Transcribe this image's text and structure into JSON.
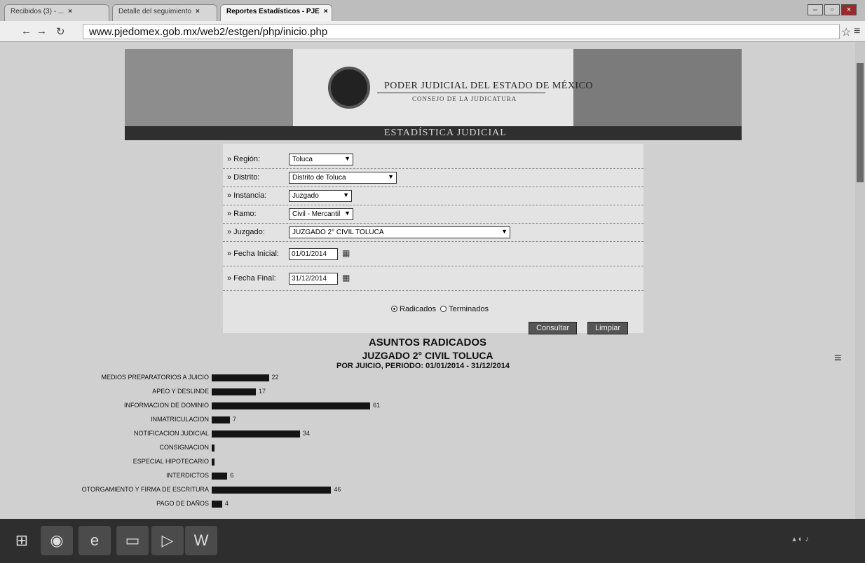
{
  "browser": {
    "tabs": [
      {
        "label": "Recibidos (3) - ...",
        "active": false
      },
      {
        "label": "Detalle del seguimiento",
        "active": false
      },
      {
        "label": "Reportes Estadísticos - PJE",
        "active": true
      }
    ],
    "url": "www.pjedomex.gob.mx/web2/estgen/php/inicio.php"
  },
  "banner": {
    "title": "PODER JUDICIAL DEL ESTADO DE MÉXICO",
    "subtitle": "CONSEJO DE LA JUDICATURA",
    "section": "ESTADÍSTICA JUDICIAL"
  },
  "form": {
    "region": {
      "label": "» Región:",
      "value": "Toluca"
    },
    "distrito": {
      "label": "» Distrito:",
      "value": "Distrito de Toluca"
    },
    "instancia": {
      "label": "» Instancia:",
      "value": "Juzgado"
    },
    "ramo": {
      "label": "» Ramo:",
      "value": "Civil - Mercantil"
    },
    "juzgado": {
      "label": "» Juzgado:",
      "value": "JUZGADO 2° CIVIL TOLUCA"
    },
    "fecha_inicial": {
      "label": "» Fecha Inicial:",
      "value": "01/01/2014"
    },
    "fecha_final": {
      "label": "» Fecha Final:",
      "value": "31/12/2014"
    },
    "radio_radicados": "Radicados",
    "radio_terminados": "Terminados",
    "btn_consultar": "Consultar",
    "btn_limpiar": "Limpiar"
  },
  "report": {
    "title": "ASUNTOS RADICADOS",
    "subtitle": "JUZGADO 2° CIVIL TOLUCA",
    "period": "POR JUICIO, PERIODO: 01/01/2014 - 31/12/2014"
  },
  "chart_data": {
    "type": "bar",
    "orientation": "horizontal",
    "categories": [
      "MEDIOS PREPARATORIOS A JUICIO",
      "APEO Y DESLINDE",
      "INFORMACION DE DOMINIO",
      "INMATRICULACION",
      "NOTIFICACION JUDICIAL",
      "CONSIGNACION",
      "ESPECIAL HIPOTECARIO",
      "INTERDICTOS",
      "OTORGAMIENTO Y FIRMA DE ESCRITURA",
      "PAGO DE DAÑOS"
    ],
    "values": [
      22,
      17,
      61,
      7,
      34,
      1,
      1,
      6,
      46,
      4
    ],
    "value_labels": [
      "22",
      "17",
      "61",
      "7",
      "34",
      "",
      "",
      "6",
      "46",
      "4"
    ],
    "title": "ASUNTOS RADICADOS",
    "xlim": [
      0,
      61
    ]
  }
}
